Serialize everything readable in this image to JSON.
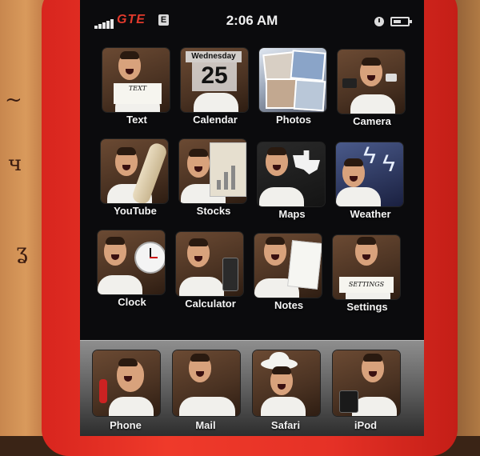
{
  "status_bar": {
    "carrier": "GTE",
    "network": "E",
    "time": "2:06 AM",
    "signal_bars": 5
  },
  "calendar_icon": {
    "day": "Wednesday",
    "date": "25"
  },
  "text_icon": {
    "sign": "TEXT"
  },
  "settings_icon": {
    "sign": "SETTINGS"
  },
  "apps": [
    {
      "label": "Text"
    },
    {
      "label": "Calendar"
    },
    {
      "label": "Photos"
    },
    {
      "label": "Camera"
    },
    {
      "label": "YouTube"
    },
    {
      "label": "Stocks"
    },
    {
      "label": "Maps"
    },
    {
      "label": "Weather"
    },
    {
      "label": "Clock"
    },
    {
      "label": "Calculator"
    },
    {
      "label": "Notes"
    },
    {
      "label": "Settings"
    }
  ],
  "dock": [
    {
      "label": "Phone"
    },
    {
      "label": "Mail"
    },
    {
      "label": "Safari"
    },
    {
      "label": "iPod"
    }
  ],
  "colors": {
    "case_red": "#e53126",
    "carrier_red": "#e23a2c",
    "screen_bg": "#0b0b0d"
  }
}
